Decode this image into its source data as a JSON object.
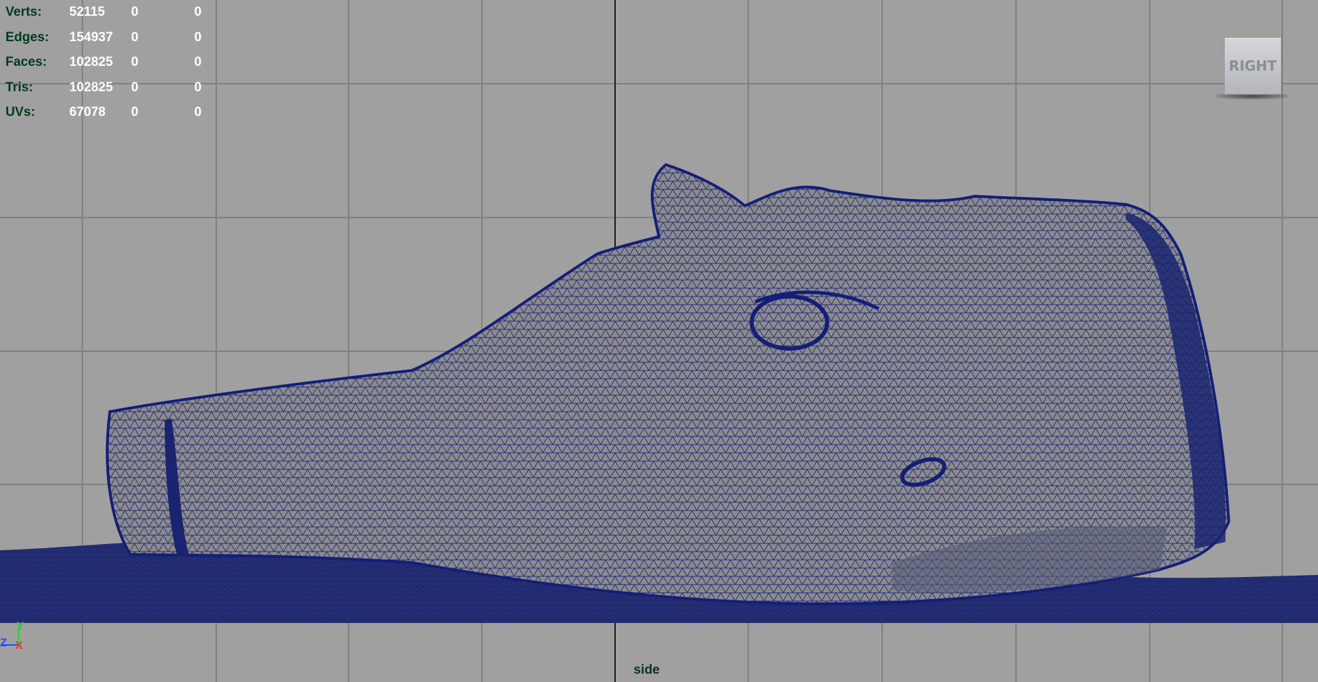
{
  "stats": [
    {
      "label": "Verts:",
      "values": [
        "52115",
        "0",
        "0"
      ]
    },
    {
      "label": "Edges:",
      "values": [
        "154937",
        "0",
        "0"
      ]
    },
    {
      "label": "Faces:",
      "values": [
        "102825",
        "0",
        "0"
      ]
    },
    {
      "label": "Tris:",
      "values": [
        "102825",
        "0",
        "0"
      ]
    },
    {
      "label": "UVs:",
      "values": [
        "67078",
        "0",
        "0"
      ]
    }
  ],
  "viewcube": {
    "label": "RIGHT"
  },
  "camera": {
    "name": "side"
  },
  "axis_gizmo": {
    "up": "Y",
    "left": "Z",
    "right": "X"
  },
  "colors": {
    "background": "#a0a0a0",
    "grid": "#7f7f7f",
    "grid_axis": "#1a1a1a",
    "wireframe": "#141e78",
    "mesh_fill": "#8c8c8c",
    "hud_label": "#003a1c",
    "hud_value": "#ffffff",
    "axis_y": "#2ecc40",
    "axis_z": "#2050ff",
    "axis_x": "#e8382a"
  }
}
